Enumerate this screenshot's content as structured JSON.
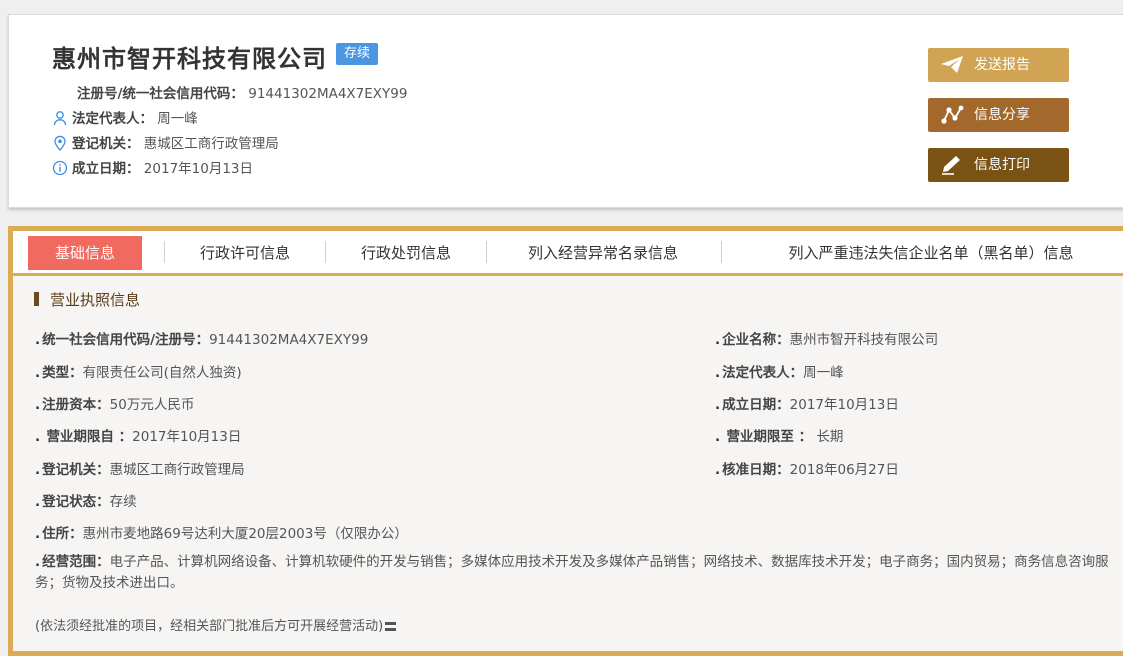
{
  "header": {
    "company_name": "惠州市智开科技有限公司",
    "status": "存续",
    "code_label": "注册号/统一社会信用代码：",
    "code_value": "91441302MA4X7EXY99",
    "legal_label": "法定代表人：",
    "legal_value": "周一峰",
    "authority_label": "登记机关：",
    "authority_value": "惠城区工商行政管理局",
    "date_label": "成立日期：",
    "date_value": "2017年10月13日"
  },
  "actions": {
    "send": "发送报告",
    "share": "信息分享",
    "print": "信息打印"
  },
  "colors": {
    "status_badge": "#4a96e0",
    "send_button": "#d0a453",
    "share_button": "#a3682c",
    "print_button": "#7a5214",
    "active_tab": "#f06a60",
    "panel_border": "#d9ac55"
  },
  "tabs": [
    {
      "label": "基础信息",
      "active": true
    },
    {
      "label": "行政许可信息",
      "active": false
    },
    {
      "label": "行政处罚信息",
      "active": false
    },
    {
      "label": "列入经营异常名录信息",
      "active": false
    },
    {
      "label": "列入严重违法失信企业名单（黑名单）信息",
      "active": false
    }
  ],
  "section": {
    "title": "营业执照信息",
    "fields": {
      "credit_code": {
        "label": "统一社会信用代码/注册号：",
        "value": "91441302MA4X7EXY99"
      },
      "company_name": {
        "label": "企业名称：",
        "value": "惠州市智开科技有限公司"
      },
      "type": {
        "label": "类型：",
        "value": "有限责任公司(自然人独资)"
      },
      "legal_rep": {
        "label": "法定代表人：",
        "value": "周一峰"
      },
      "capital": {
        "label": "注册资本：",
        "value": "50万元人民币"
      },
      "established": {
        "label": "成立日期：",
        "value": "2017年10月13日"
      },
      "term_from": {
        "label": "营业期限自 ：",
        "value": "2017年10月13日"
      },
      "term_to": {
        "label": "营业期限至 ：",
        "value": "长期"
      },
      "authority": {
        "label": "登记机关：",
        "value": "惠城区工商行政管理局"
      },
      "approved": {
        "label": "核准日期：",
        "value": "2018年06月27日"
      },
      "reg_status": {
        "label": "登记状态：",
        "value": "存续"
      },
      "address": {
        "label": "住所：",
        "value": "惠州市麦地路69号达利大厦20层2003号（仅限办公）"
      },
      "scope": {
        "label": "经营范围：",
        "value": "电子产品、计算机网络设备、计算机软硬件的开发与销售；多媒体应用技术开发及多媒体产品销售；网络技术、数据库技术开发；电子商务；国内贸易；商务信息咨询服务；货物及技术进出口。"
      }
    },
    "note": "(依法须经批准的项目，经相关部门批准后方可开展经营活动)"
  }
}
